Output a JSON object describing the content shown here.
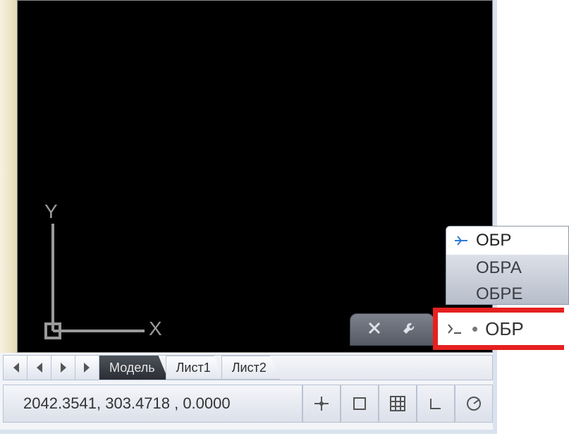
{
  "ucs": {
    "x_label": "X",
    "y_label": "Y"
  },
  "tabs": {
    "model": "Модель",
    "sheet1": "Лист1",
    "sheet2": "Лист2"
  },
  "status": {
    "coords": "2042.3541, 303.4718 , 0.0000"
  },
  "command_input": {
    "text": "ОБР"
  },
  "suggestions": {
    "item1": "ОБР",
    "item2": "ОБРА",
    "item3": "ОБРЕ"
  }
}
